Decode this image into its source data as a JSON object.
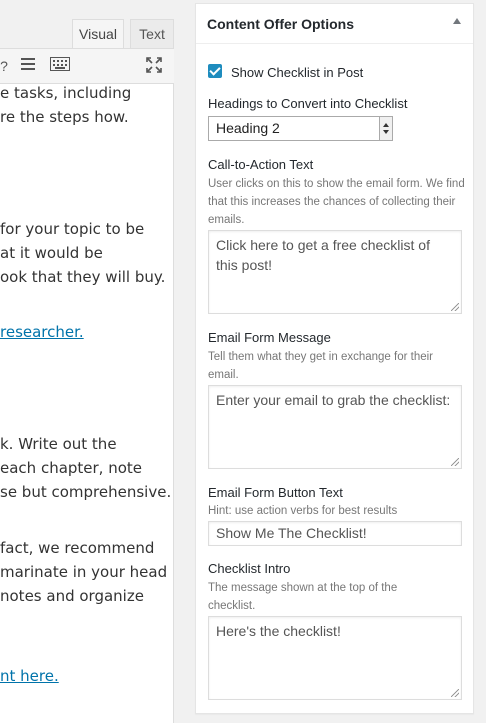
{
  "editor": {
    "tabs": {
      "visual": "Visual",
      "text": "Text"
    },
    "lines": [
      "e tasks, including",
      "re the steps how.",
      "for your topic to be",
      "at it would be",
      "ook that they will buy.",
      "researcher.",
      "k. Write out the",
      "each chapter, note",
      "se but comprehensive.",
      "fact, we recommend",
      "marinate in your head",
      "notes and organize",
      "nt here."
    ]
  },
  "metabox": {
    "title": "Content Offer Options",
    "show_checklist": {
      "label": "Show Checklist in Post",
      "checked": true
    },
    "headings": {
      "label": "Headings to Convert into Checklist",
      "selected": "Heading 2"
    },
    "cta": {
      "label": "Call-to-Action Text",
      "hint": "User clicks on this to show the email form. We find that this increases the chances of collecting their emails.",
      "value": "Click here to get a free checklist of this post!"
    },
    "email_message": {
      "label": "Email Form Message",
      "hint": "Tell them what they get in exchange for their email.",
      "value": "Enter your email to grab the checklist:"
    },
    "button_text": {
      "label": "Email Form Button Text",
      "hint": "Hint: use action verbs for best results",
      "value": "Show Me The Checklist!"
    },
    "intro": {
      "label": "Checklist Intro",
      "hint": "The message shown at the top of the checklist.",
      "value": "Here's the checklist!"
    }
  },
  "colors": {
    "accent": "#1e8cbe",
    "link": "#0073aa"
  }
}
